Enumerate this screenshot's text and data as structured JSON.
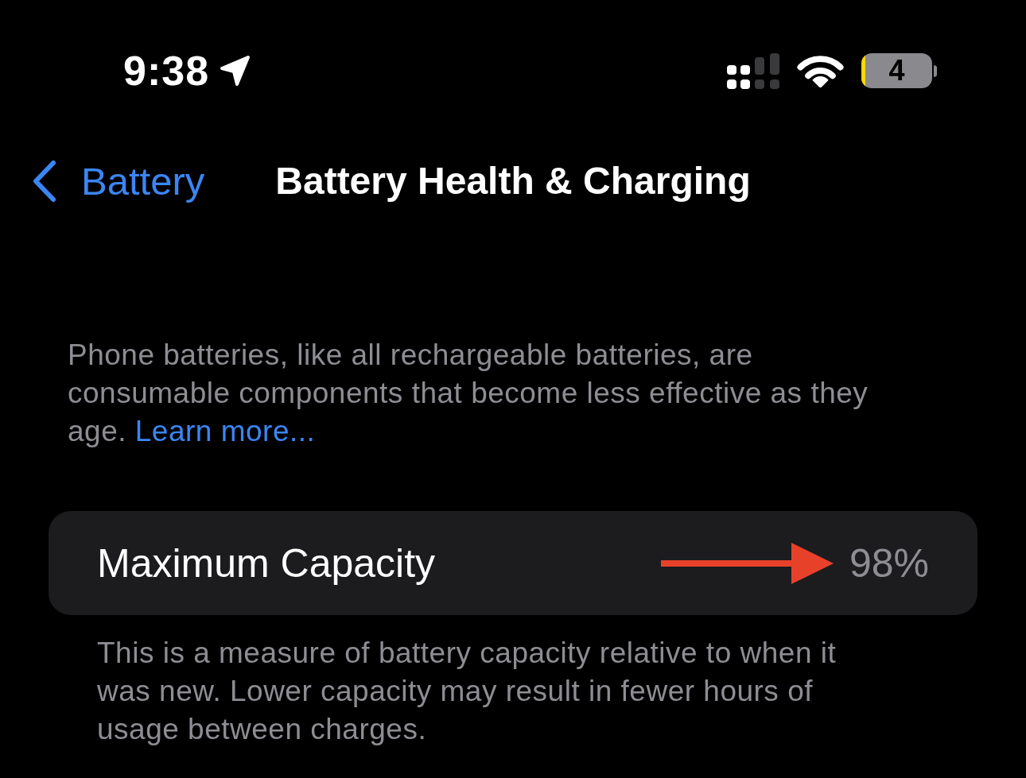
{
  "status_bar": {
    "time": "9:38",
    "battery_percent": "4",
    "low_power_mode": true
  },
  "nav": {
    "back_label": "Battery",
    "title": "Battery Health & Charging"
  },
  "intro": {
    "text": "Phone batteries, like all rechargeable batteries, are consumable components that become less effective as they age.",
    "link": "Learn more..."
  },
  "capacity_row": {
    "label": "Maximum Capacity",
    "value": "98%"
  },
  "footer_note": "This is a measure of battery capacity relative to when it was new. Lower capacity may result in fewer hours of usage between charges."
}
